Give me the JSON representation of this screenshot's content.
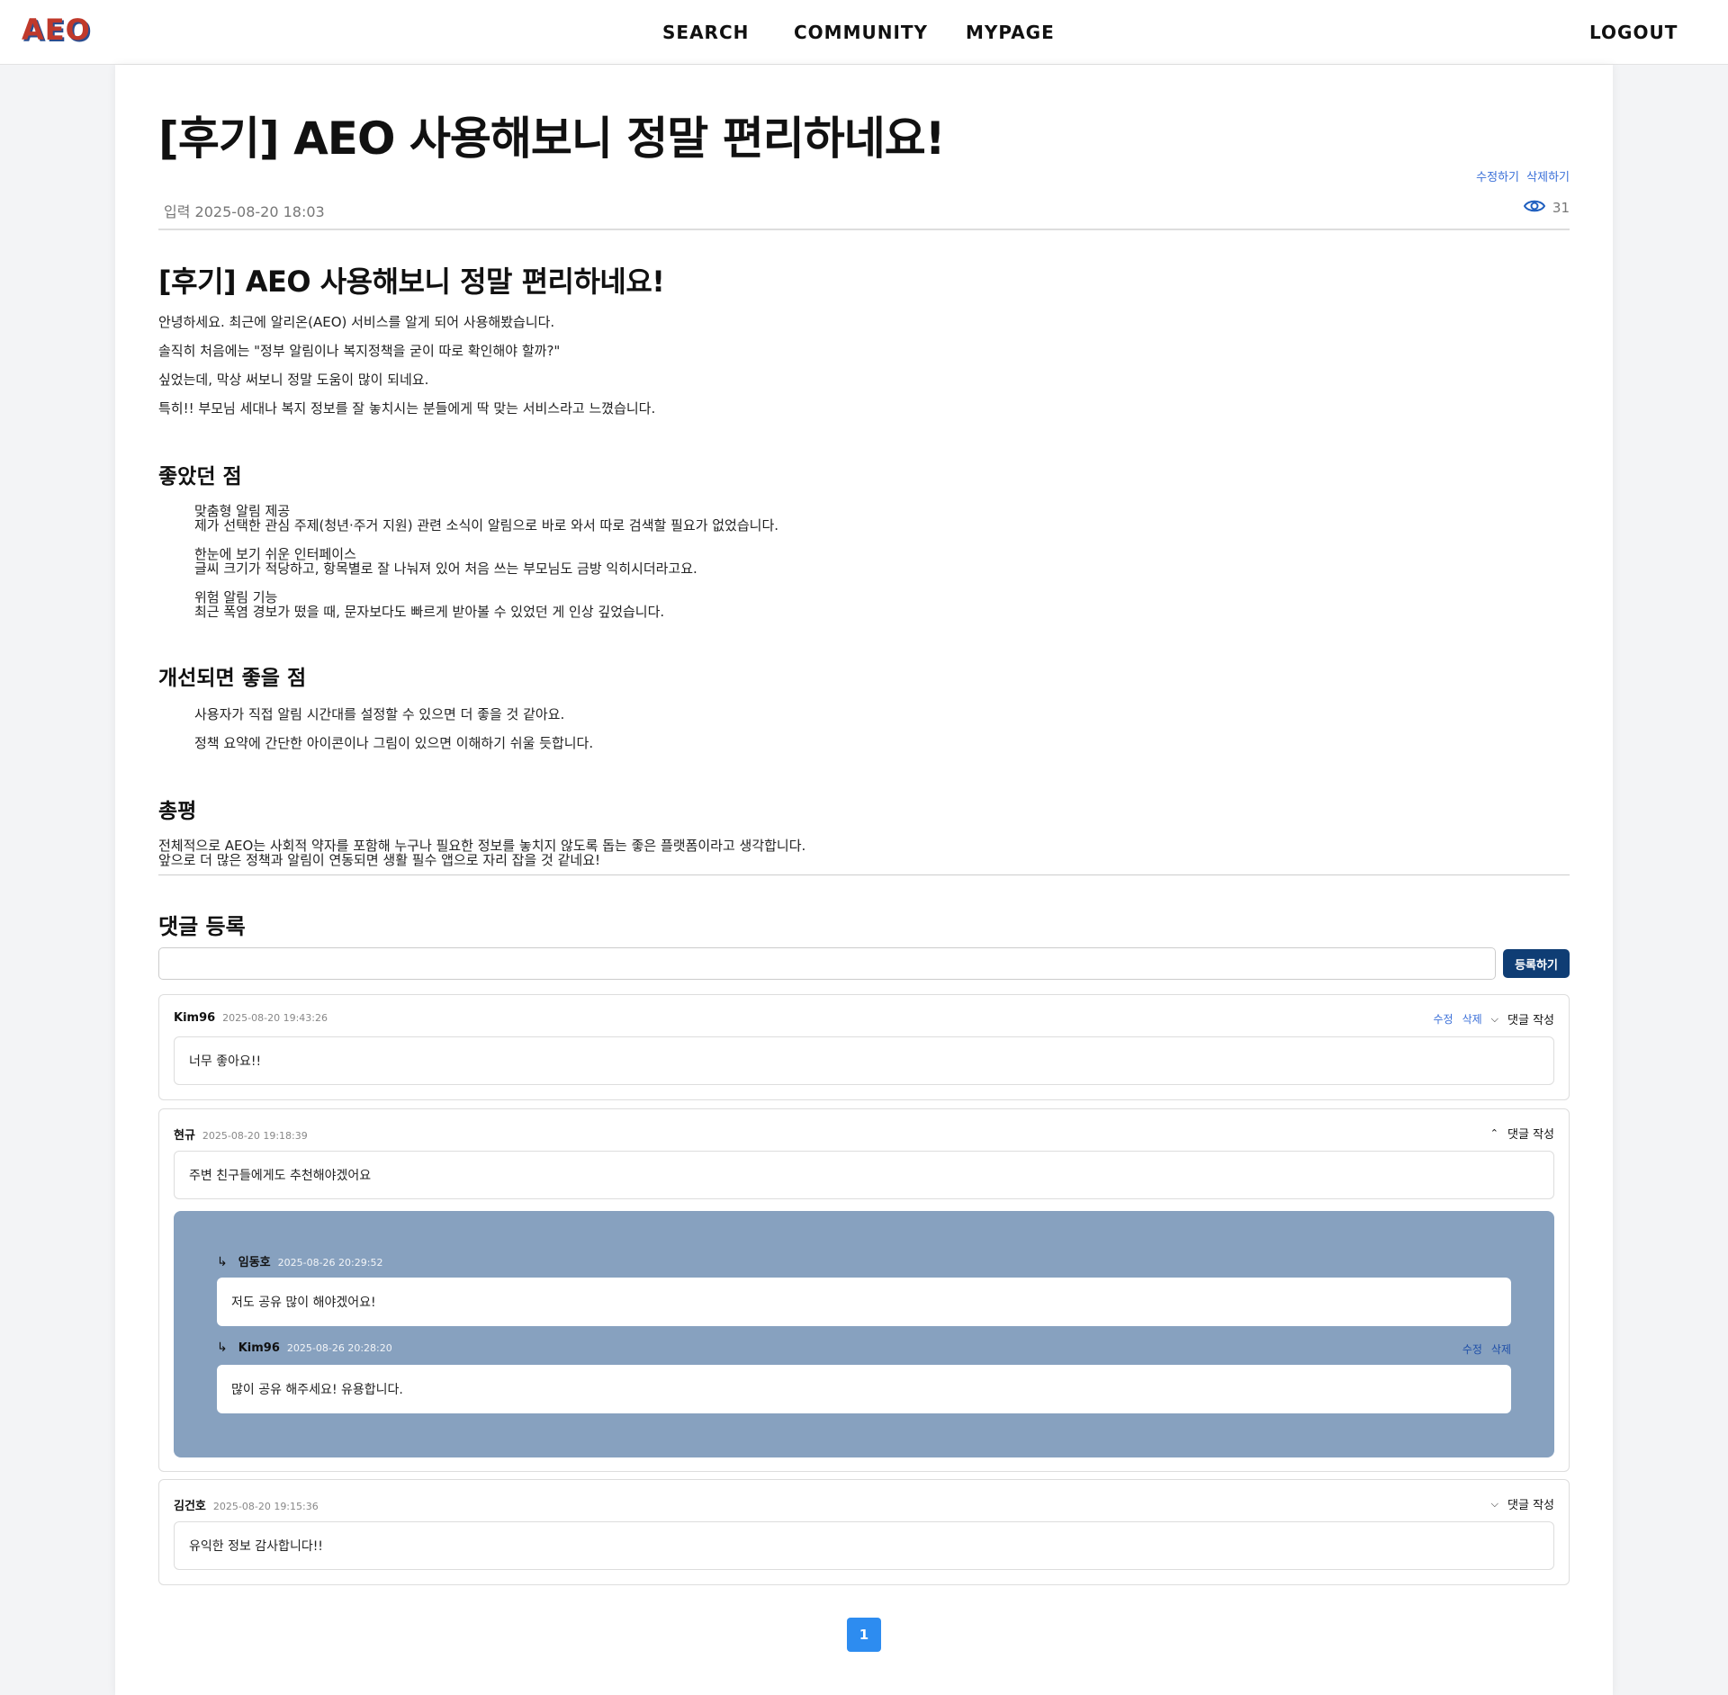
{
  "header": {
    "logo": "AEO",
    "nav": {
      "search": "SEARCH",
      "community": "COMMUNITY",
      "mypage": "MYPAGE",
      "logout": "LOGOUT"
    }
  },
  "post": {
    "title": "[후기] AEO 사용해보니 정말 편리하네요!",
    "edit_label": "수정하기",
    "delete_label": "삭제하기",
    "date": "입력 2025-08-20 18:03",
    "views": "31",
    "content": {
      "heading": "[후기] AEO 사용해보니 정말 편리하네요!",
      "intro": [
        "안녕하세요. 최근에 알리온(AEO) 서비스를 알게 되어 사용해봤습니다.",
        "솔직히 처음에는 \"정부 알림이나 복지정책을 굳이 따로 확인해야 할까?\"",
        "싶었는데, 막상 써보니 정말 도움이 많이 되네요.",
        "특히!! 부모님 세대나 복지 정보를 잘 놓치시는 분들에게 딱 맞는 서비스라고 느꼈습니다."
      ],
      "good_heading": "좋았던 점",
      "good_items": [
        {
          "title": "맞춤형 알림 제공",
          "desc": "제가 선택한 관심 주제(청년·주거 지원) 관련 소식이 알림으로 바로 와서 따로 검색할 필요가 없었습니다."
        },
        {
          "title": "한눈에 보기 쉬운 인터페이스",
          "desc": "글씨 크기가 적당하고, 항목별로 잘 나눠져 있어 처음 쓰는 부모님도 금방 익히시더라고요."
        },
        {
          "title": "위험 알림 기능",
          "desc": "최근 폭염 경보가 떴을 때, 문자보다도 빠르게 받아볼 수 있었던 게 인상 깊었습니다."
        }
      ],
      "improve_heading": "개선되면 좋을 점",
      "improve_items": [
        "사용자가 직접 알림 시간대를 설정할 수 있으면 더 좋을 것 같아요.",
        "정책 요약에 간단한 아이콘이나 그림이 있으면 이해하기 쉬울 듯합니다."
      ],
      "summary_heading": "총평",
      "summary_lines": [
        "전체적으로 AEO는 사회적 약자를 포함해 누구나 필요한 정보를 놓치지 않도록 돕는 좋은 플랫폼이라고 생각합니다.",
        "앞으로 더 많은 정책과 알림이 연동되면 생활 필수 앱으로 자리 잡을 것 같네요!"
      ]
    }
  },
  "comments_section": {
    "title": "댓글 등록",
    "input_value": "",
    "submit_label": "등록하기",
    "edit_label": "수정",
    "delete_label": "삭제",
    "reply_label": "댓글 작성",
    "comments": [
      {
        "author": "Kim96",
        "time": "2025-08-20 19:43:26",
        "text": "너무 좋아요!!"
      },
      {
        "author": "현규",
        "time": "2025-08-20 19:18:39",
        "text": "주변 친구들에게도 추천해야겠어요",
        "replies": [
          {
            "author": "임동호",
            "time": "2025-08-26 20:29:52",
            "text": "저도 공유 많이 해야겠어요!"
          },
          {
            "author": "Kim96",
            "time": "2025-08-26 20:28:20",
            "text": "많이 공유 해주세요! 유용합니다."
          }
        ]
      },
      {
        "author": "김건호",
        "time": "2025-08-20 19:15:36",
        "text": "유익한 정보 감사합니다!!"
      }
    ]
  },
  "pagination": {
    "current": "1"
  },
  "colors": {
    "primary_dark": "#0f3d74",
    "link": "#3a6fd8",
    "reply_panel": "#87a1bf",
    "page_active": "#2d8cf0"
  }
}
